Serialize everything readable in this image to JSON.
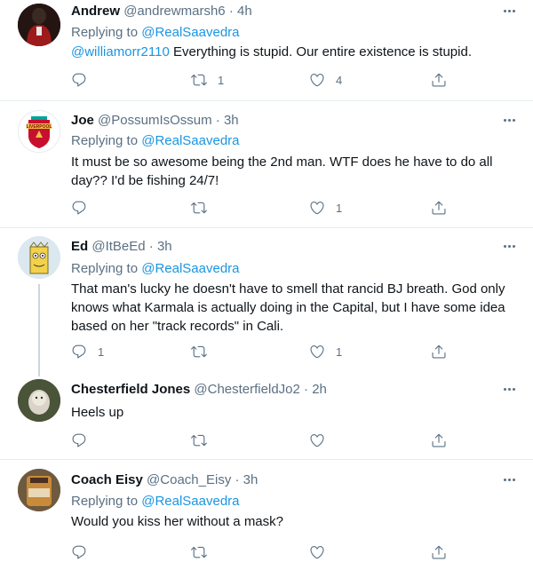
{
  "tweets": [
    {
      "name": "Andrew",
      "handle": "@andrewmarsh6",
      "time": "4h",
      "replying_label": "Replying to",
      "replying_to": "@RealSaavedra",
      "mention": "@williamorr2110",
      "text": "Everything is stupid. Our entire existence is stupid.",
      "retweets": "1",
      "likes": "4",
      "replies": ""
    },
    {
      "name": "Joe",
      "handle": "@PossumIsOssum",
      "time": "3h",
      "replying_label": "Replying to",
      "replying_to": "@RealSaavedra",
      "text": "It must be so awesome being the 2nd man. WTF does he have to do all day?? I'd be fishing 24/7!",
      "retweets": "",
      "likes": "1",
      "replies": ""
    },
    {
      "name": "Ed",
      "handle": "@ItBeEd",
      "time": "3h",
      "replying_label": "Replying to",
      "replying_to": "@RealSaavedra",
      "text": "That man's lucky he doesn't have to smell that rancid BJ breath. God only knows what Karmala is actually doing in the Capital, but I have some idea based on her \"track records\" in Cali.",
      "retweets": "",
      "likes": "1",
      "replies": "1"
    },
    {
      "name": "Chesterfield Jones",
      "handle": "@ChesterfieldJo2",
      "time": "2h",
      "text": "Heels up",
      "retweets": "",
      "likes": "",
      "replies": ""
    },
    {
      "name": "Coach Eisy",
      "handle": "@Coach_Eisy",
      "time": "3h",
      "replying_label": "Replying to",
      "replying_to": "@RealSaavedra",
      "text": "Would you kiss her without a mask?",
      "retweets": "",
      "likes": "",
      "replies": ""
    }
  ],
  "separator": "·",
  "icons": {
    "reply": "reply-icon",
    "retweet": "retweet-icon",
    "like": "heart-icon",
    "share": "share-icon",
    "more": "more-icon"
  },
  "colors": {
    "link": "#1b95e0",
    "secondary": "#5b7083",
    "divider": "#e6ecf0",
    "thread_line": "#ccd6dd"
  }
}
